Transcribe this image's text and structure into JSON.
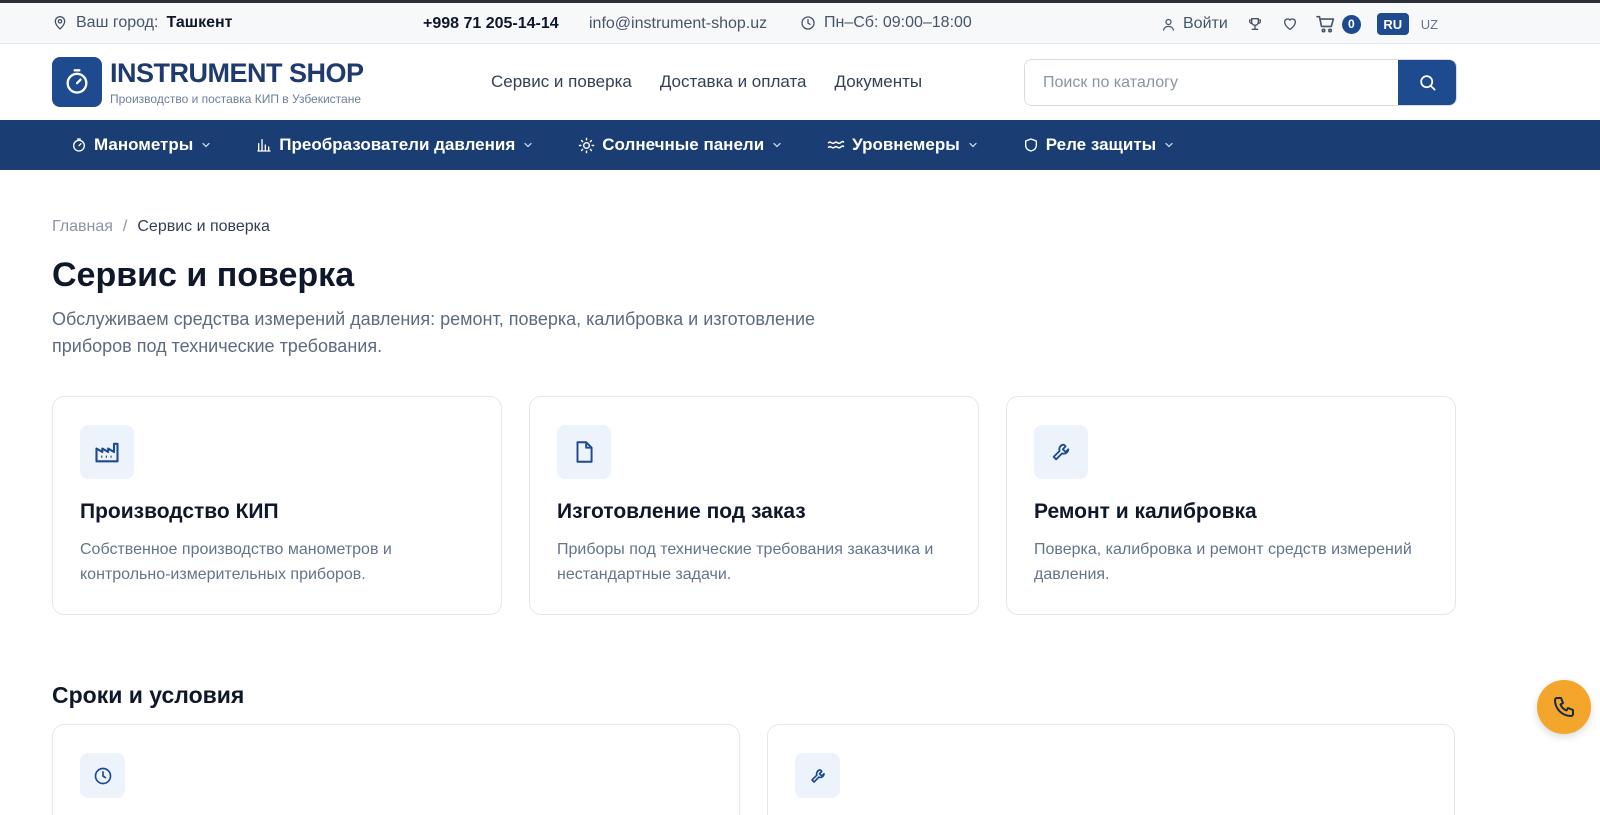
{
  "topbar": {
    "city_label": "Ваш город:",
    "city": "Ташкент",
    "phone": "+998 71 205-14-14",
    "email": "info@instrument-shop.uz",
    "hours": "Пн–Сб: 09:00–18:00",
    "login": "Войти",
    "cart_count": "0",
    "lang_active": "RU",
    "lang_other": "UZ"
  },
  "header": {
    "logo_title": "INSTRUMENT SHOP",
    "logo_subtitle": "Производство и поставка КИП в Узбекистане",
    "nav": [
      "Сервис и поверка",
      "Доставка и оплата",
      "Документы"
    ],
    "search_placeholder": "Поиск по каталогу"
  },
  "catnav": [
    {
      "label": "Манометры",
      "icon": "gauge-icon"
    },
    {
      "label": "Преобразователи давления",
      "icon": "bars-icon"
    },
    {
      "label": "Солнечные панели",
      "icon": "sun-icon"
    },
    {
      "label": "Уровнемеры",
      "icon": "waves-icon"
    },
    {
      "label": "Реле защиты",
      "icon": "shield-icon"
    }
  ],
  "breadcrumb": {
    "home": "Главная",
    "sep": "/",
    "current": "Сервис и поверка"
  },
  "page": {
    "title": "Сервис и поверка",
    "lead": "Обслуживаем средства измерений давления: ремонт, поверка, калибровка и изготовление приборов под технические требования."
  },
  "services": [
    {
      "icon": "factory-icon",
      "title": "Производство КИП",
      "text": "Собственное производство манометров и контрольно-измерительных приборов."
    },
    {
      "icon": "document-icon",
      "title": "Изготовление под заказ",
      "text": "Приборы под технические требования заказчика и нестандартные задачи."
    },
    {
      "icon": "wrench-icon",
      "title": "Ремонт и калибровка",
      "text": "Поверка, калибровка и ремонт средств измерений давления."
    }
  ],
  "terms": {
    "title": "Сроки и условия",
    "cards": [
      {
        "icon": "clock-icon"
      },
      {
        "icon": "wrench-icon"
      }
    ]
  },
  "colors": {
    "brand": "#1e4b8f",
    "nav_bg": "#1a3d73",
    "accent": "#f4a52b"
  }
}
